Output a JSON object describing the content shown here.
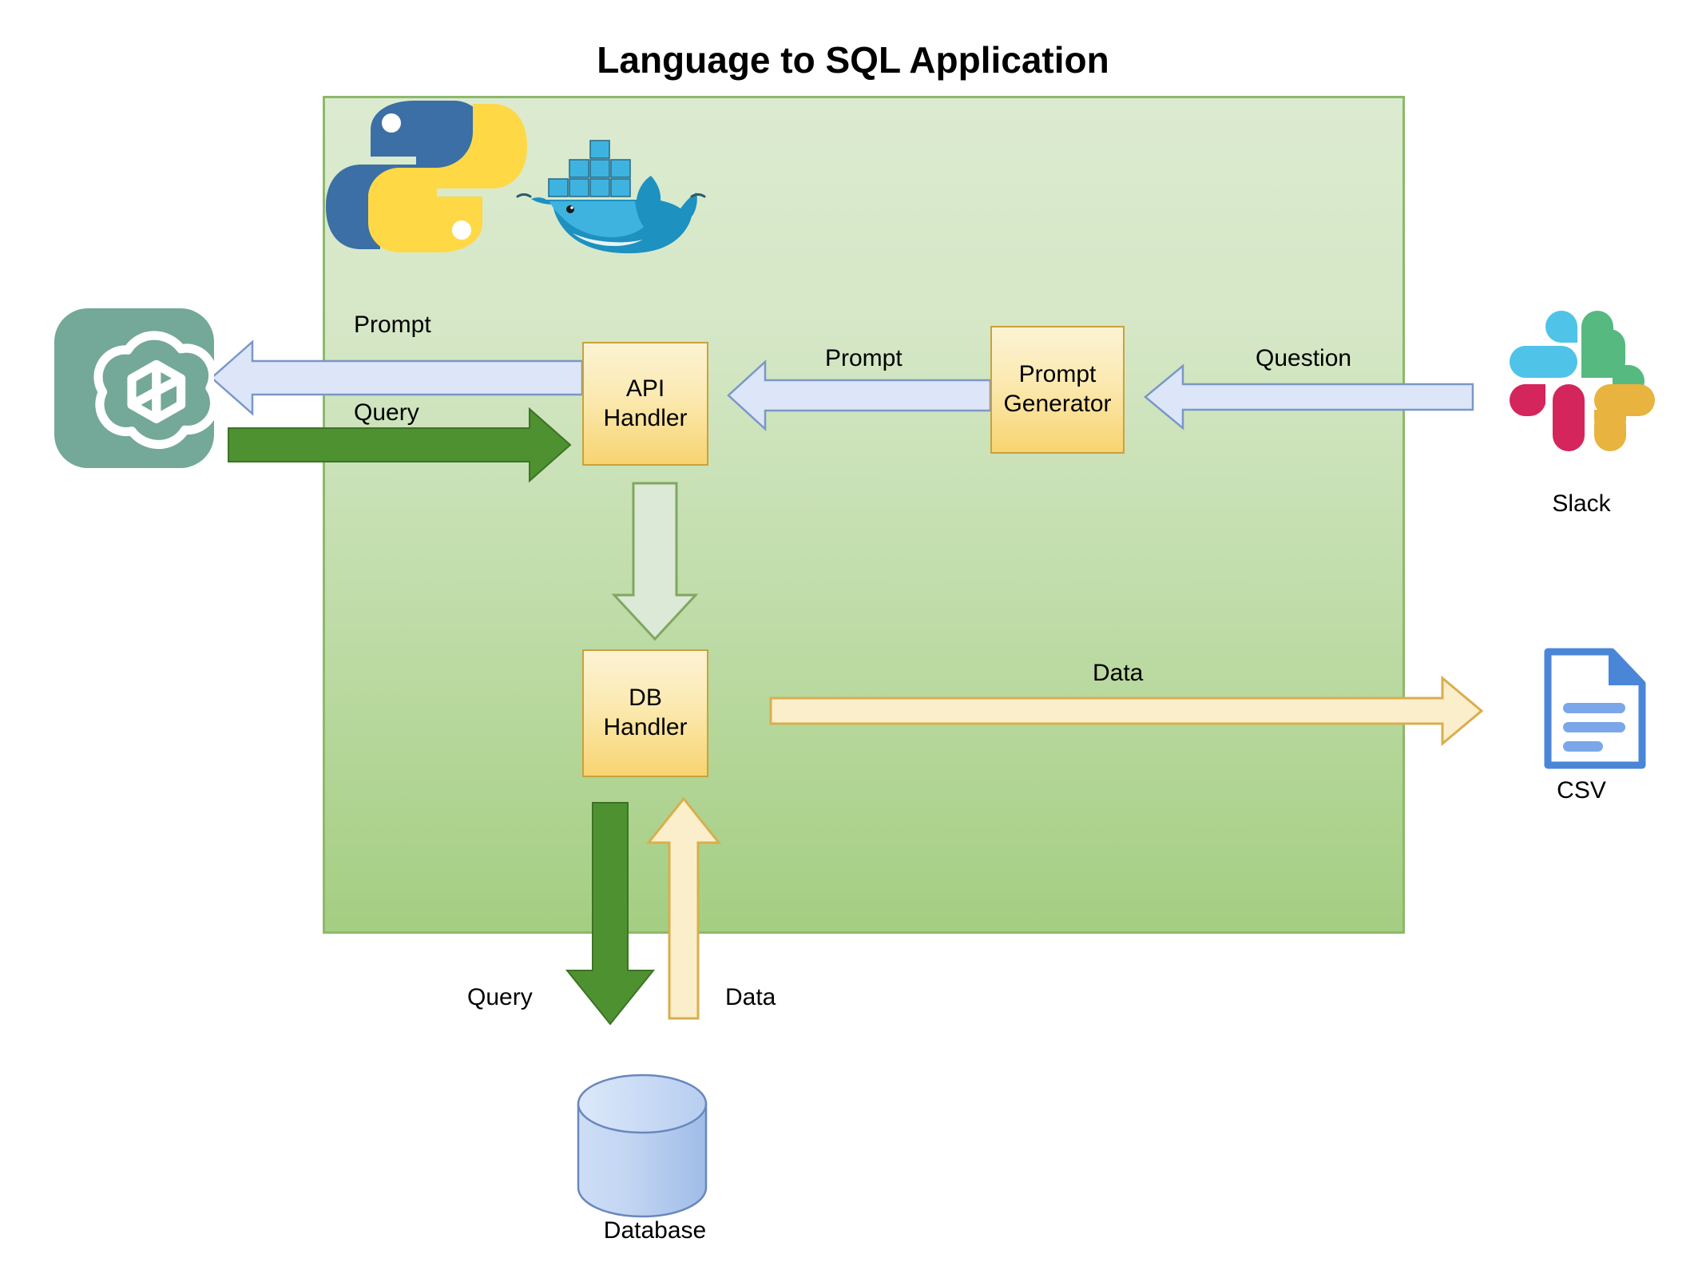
{
  "title": "Language to SQL Application",
  "container": {
    "name": "application-boundary",
    "fill_top": "#DCEBD0",
    "fill_bottom": "#A4CE82",
    "border": "#8CB96B"
  },
  "tech_logos": [
    {
      "id": "python",
      "name": "python-logo",
      "colors": [
        "#3B6FA5",
        "#FFD845"
      ]
    },
    {
      "id": "docker",
      "name": "docker-logo",
      "colors": [
        "#2396ED",
        "#0A7CC1"
      ]
    }
  ],
  "boxes": [
    {
      "id": "api_handler",
      "label": "API\nHandler",
      "line1": "API",
      "line2": "Handler",
      "fill": "#FBE9B0",
      "border": "#C9A23C"
    },
    {
      "id": "prompt_gen",
      "label": "Prompt\nGenerator",
      "line1": "Prompt",
      "line2": "Generator",
      "fill": "#FBE9B0",
      "border": "#C9A23C"
    },
    {
      "id": "db_handler",
      "label": "DB\nHandler",
      "line1": "DB",
      "line2": "Handler",
      "fill": "#FBE9B0",
      "border": "#C9A23C"
    }
  ],
  "external_nodes": [
    {
      "id": "openai",
      "caption": "",
      "icon": "openai-logo",
      "color": "#74A898"
    },
    {
      "id": "slack",
      "caption": "Slack",
      "icon": "slack-logo",
      "colors": [
        "#4FC3E8",
        "#56B97F",
        "#D4255C",
        "#E8B33E"
      ]
    },
    {
      "id": "csv",
      "caption": "CSV",
      "icon": "csv-file-icon",
      "color": "#4A86D8"
    },
    {
      "id": "database",
      "caption": "Database",
      "icon": "database-cylinder-icon",
      "color": "#A8C0E8"
    }
  ],
  "flows": [
    {
      "id": "prompt_to_openai",
      "label": "Prompt",
      "from": "api_handler",
      "to": "openai",
      "direction": "left",
      "color": "#DCE6F8",
      "border": "#7B97C8"
    },
    {
      "id": "query_from_openai",
      "label": "Query",
      "from": "openai",
      "to": "api_handler",
      "direction": "right",
      "color": "#4E9131",
      "border": "#3D7326"
    },
    {
      "id": "prompt_to_api",
      "label": "Prompt",
      "from": "prompt_gen",
      "to": "api_handler",
      "direction": "left",
      "color": "#DCE6F8",
      "border": "#7B97C8"
    },
    {
      "id": "question_in",
      "label": "Question",
      "from": "slack",
      "to": "prompt_gen",
      "direction": "left",
      "color": "#DCE6F8",
      "border": "#7B97C8"
    },
    {
      "id": "api_to_db",
      "label": "",
      "from": "api_handler",
      "to": "db_handler",
      "direction": "down",
      "color": "#DCE9D6",
      "border": "#7FA861"
    },
    {
      "id": "data_to_csv",
      "label": "Data",
      "from": "db_handler",
      "to": "csv",
      "direction": "right",
      "color": "#FBEECB",
      "border": "#D9AE4E"
    },
    {
      "id": "query_to_db",
      "label": "Query",
      "from": "db_handler",
      "to": "database",
      "direction": "down",
      "color": "#4E9131",
      "border": "#3D7326"
    },
    {
      "id": "data_from_db",
      "label": "Data",
      "from": "database",
      "to": "db_handler",
      "direction": "up",
      "color": "#FBEECB",
      "border": "#D9AE4E"
    }
  ]
}
